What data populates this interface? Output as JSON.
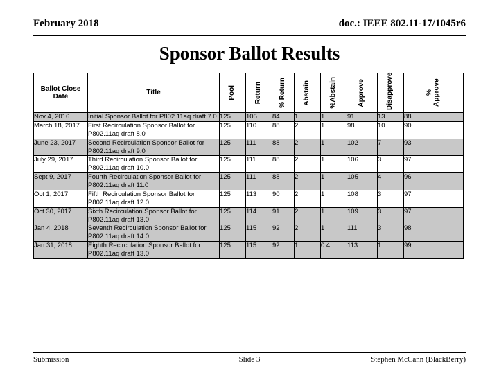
{
  "header": {
    "left": "February 2018",
    "right": "doc.: IEEE 802.11-17/1045r6"
  },
  "title": "Sponsor Ballot Results",
  "footer": {
    "left": "Submission",
    "center": "Slide 3",
    "right": "Stephen McCann (BlackBerry)"
  },
  "colors": {
    "row_shade": "#c8c8c8",
    "row_plain": "#ffffff",
    "border": "#000000",
    "text": "#000000"
  },
  "chart_data": {
    "type": "table",
    "title": "Sponsor Ballot Results",
    "columns": [
      "Ballot Close Date",
      "Title",
      "Pool",
      "Return",
      "% Return",
      "Abstain",
      "%Abstain",
      "Approve",
      "Disapprove",
      "% Approve"
    ],
    "column_orientation": [
      "horizontal",
      "horizontal",
      "vertical",
      "vertical",
      "vertical",
      "vertical",
      "vertical",
      "vertical",
      "vertical",
      "vertical"
    ],
    "rows": [
      {
        "shaded": true,
        "date": "Nov 4, 2016",
        "ballot_title": "Initial Sponsor Ballot for P802.11aq draft 7.0",
        "pool": "125",
        "return": "105",
        "pct_return": "84",
        "abstain": "1",
        "pct_abstain": "1",
        "approve": "91",
        "disapprove": "13",
        "pct_approve": "88"
      },
      {
        "shaded": false,
        "date": "March 18, 2017",
        "ballot_title": "First Recirculation Sponsor  Ballot for P802.11aq draft 8.0",
        "pool": "125",
        "return": "110",
        "pct_return": "88",
        "abstain": "2",
        "pct_abstain": "1",
        "approve": "98",
        "disapprove": "10",
        "pct_approve": "90"
      },
      {
        "shaded": true,
        "date": "June 23, 2017",
        "ballot_title": "Second Recirculation Sponsor Ballot for P802.11aq draft 9.0",
        "pool": "125",
        "return": "111",
        "pct_return": "88",
        "abstain": "2",
        "pct_abstain": "1",
        "approve": "102",
        "disapprove": "7",
        "pct_approve": "93"
      },
      {
        "shaded": false,
        "date": "July 29, 2017",
        "ballot_title": "Third Recirculation Sponsor Ballot for P802.11aq draft 10.0",
        "pool": "125",
        "return": "111",
        "pct_return": "88",
        "abstain": "2",
        "pct_abstain": "1",
        "approve": "106",
        "disapprove": "3",
        "pct_approve": "97"
      },
      {
        "shaded": true,
        "date": "Sept 9, 2017",
        "ballot_title": "Fourth Recirculation Sponsor Ballot for P802.11aq draft 11.0",
        "pool": "125",
        "return": "111",
        "pct_return": "88",
        "abstain": "2",
        "pct_abstain": "1",
        "approve": "105",
        "disapprove": "4",
        "pct_approve": "96"
      },
      {
        "shaded": false,
        "date": "Oct 1, 2017",
        "ballot_title": "Fifth Recirculation Sponsor Ballot for P802.11aq draft 12.0",
        "pool": "125",
        "return": "113",
        "pct_return": "90",
        "abstain": "2",
        "pct_abstain": "1",
        "approve": "108",
        "disapprove": "3",
        "pct_approve": "97"
      },
      {
        "shaded": true,
        "date": "Oct 30, 2017",
        "ballot_title": "Sixth Recirculation Sponsor Ballot for P802.11aq draft 13.0",
        "pool": "125",
        "return": "114",
        "pct_return": "91",
        "abstain": "2",
        "pct_abstain": "1",
        "approve": "109",
        "disapprove": "3",
        "pct_approve": "97"
      },
      {
        "shaded": true,
        "date": "Jan 4, 2018",
        "ballot_title": "Seventh Recirculation Sponsor Ballot for P802.11aq draft 14.0",
        "pool": "125",
        "return": "115",
        "pct_return": "92",
        "abstain": "2",
        "pct_abstain": "1",
        "approve": "111",
        "disapprove": "3",
        "pct_approve": "98"
      },
      {
        "shaded": true,
        "date": "Jan 31, 2018",
        "ballot_title": "Eighth Recirculation Sponsor Ballot for P802.11aq draft 13.0",
        "pool": "125",
        "return": "115",
        "pct_return": "92",
        "abstain": "1",
        "pct_abstain": "0.4",
        "approve": "113",
        "disapprove": "1",
        "pct_approve": "99"
      }
    ]
  }
}
